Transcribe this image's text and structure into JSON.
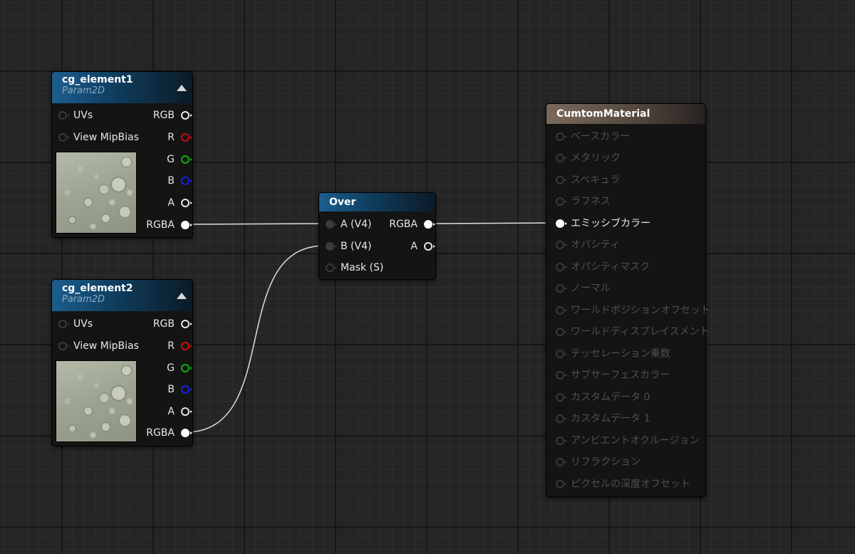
{
  "nodes": {
    "cg_element1": {
      "title": "cg_element1",
      "subtitle": "Param2D",
      "inputs": [
        "UVs",
        "View MipBias"
      ],
      "outputs": [
        "RGB",
        "R",
        "G",
        "B",
        "A",
        "RGBA"
      ]
    },
    "cg_element2": {
      "title": "cg_element2",
      "subtitle": "Param2D",
      "inputs": [
        "UVs",
        "View MipBias"
      ],
      "outputs": [
        "RGB",
        "R",
        "G",
        "B",
        "A",
        "RGBA"
      ]
    },
    "over": {
      "title": "Over",
      "inputs": [
        "A (V4)",
        "B (V4)",
        "Mask (S)"
      ],
      "outputs": [
        "RGBA",
        "A"
      ]
    },
    "material": {
      "title": "CumtomMaterial",
      "inputs": [
        "ベースカラー",
        "メタリック",
        "スペキュラ",
        "ラフネス",
        "エミッシブカラー",
        "オパシティ",
        "オパシティマスク",
        "ノーマル",
        "ワールドポジションオフセット",
        "ワールドディスプレイスメント",
        "テッセレーション乗数",
        "サブサーフェスカラー",
        "カスタムデータ 0",
        "カスタムデータ 1",
        "アンビエントオクルージョン",
        "リフラクション",
        "ピクセルの深度オフセット"
      ]
    }
  },
  "pin_colors": {
    "white": "#e6e6e6",
    "red": "#c81010",
    "green": "#10b010",
    "blue": "#1424d8",
    "inactive": "#3c3c3c"
  },
  "icons": [
    "collapse-arrow-icon",
    "texture-preview"
  ],
  "connections": [
    "cg_element1.RGBA -> Over.A (V4)",
    "cg_element2.RGBA -> Over.B (V4)",
    "Over.RGBA -> CumtomMaterial.エミッシブカラー"
  ]
}
